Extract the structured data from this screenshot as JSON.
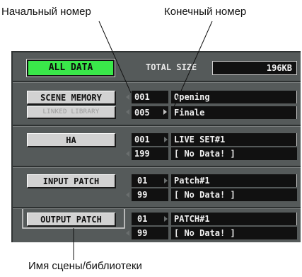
{
  "annotations": {
    "start_number": "Начальный номер",
    "end_number": "Конечный номер",
    "scene_library_name": "Имя сцены/библиотеки"
  },
  "panel": {
    "all_data_button": "ALL DATA",
    "total_size_label": "TOTAL SIZE",
    "total_size_value": "196KB",
    "rows": [
      {
        "button": "SCENE MEMORY",
        "start": "001",
        "start_name": "Opening",
        "end": "005",
        "end_name": "Finale"
      },
      {
        "button": "LINKED LIBRARY"
      },
      {
        "button": "HA",
        "start": "001",
        "start_name": "LIVE SET#1",
        "end": "199",
        "end_name": "[    No Data!    ]"
      },
      {
        "button": "INPUT PATCH",
        "start": "01",
        "start_name": "Patch#1",
        "end": "99",
        "end_name": "[    No Data!    ]"
      },
      {
        "button": "OUTPUT PATCH",
        "start": "01",
        "start_name": "PATCH#1",
        "end": "99",
        "end_name": "[    No Data!    ]"
      }
    ]
  },
  "colors": {
    "panel_bg": "#555a5a",
    "green_button": "#3ae84a",
    "button_gray": "#d2d2d2",
    "field_black": "#111111"
  }
}
